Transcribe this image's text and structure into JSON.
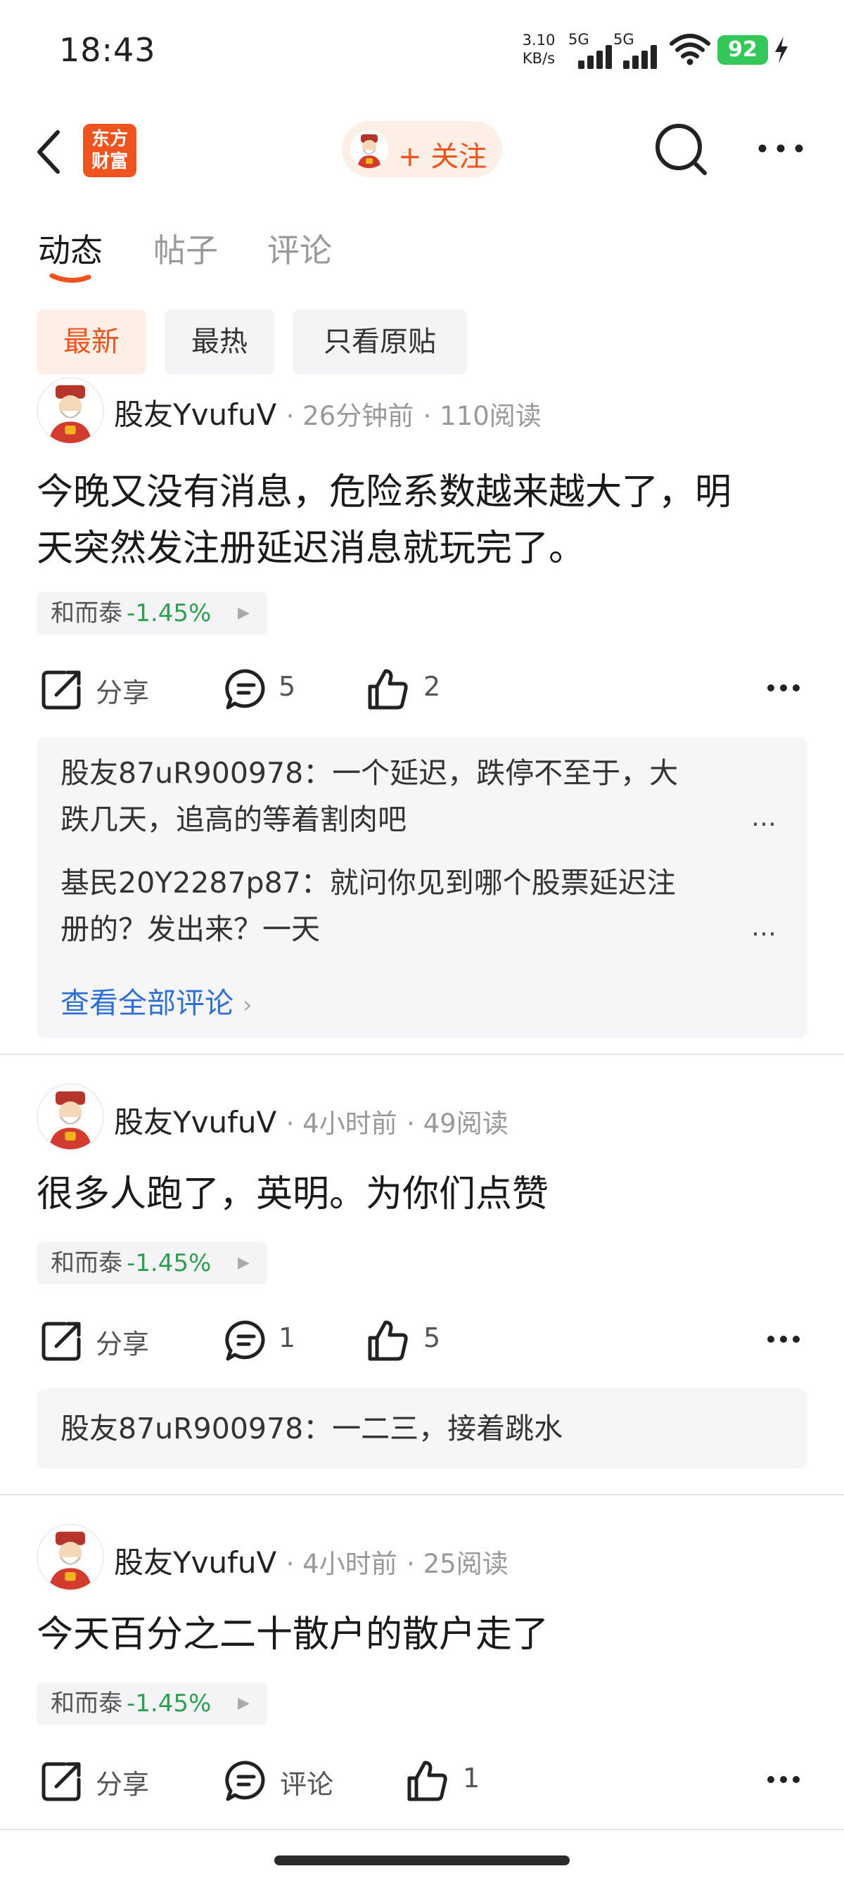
{
  "status_bar": {
    "time": "18:43",
    "net_speed_value": "3.10",
    "net_speed_unit": "KB/s",
    "sim1_label": "5G",
    "sim2_label": "5G",
    "battery": "92",
    "icons": [
      "signal-icon",
      "wifi-icon",
      "battery-icon",
      "charging-icon"
    ]
  },
  "nav": {
    "logo_line1": "东方",
    "logo_line2": "财富",
    "follow_label": "+ 关注",
    "icons": [
      "back-icon",
      "search-icon",
      "more-icon"
    ]
  },
  "tabs": [
    {
      "label": "动态",
      "active": true
    },
    {
      "label": "帖子",
      "active": false
    },
    {
      "label": "评论",
      "active": false
    }
  ],
  "filters": [
    {
      "label": "最新",
      "active": true
    },
    {
      "label": "最热",
      "active": false
    },
    {
      "label": "只看原贴",
      "active": false
    }
  ],
  "posts": [
    {
      "user": "股友YvufuV",
      "time": "26分钟前",
      "reads": "110阅读",
      "body_line1": "今晚又没有消息，危险系数越来越大了，明",
      "body_line2": "天突然发注册延迟消息就玩完了。",
      "stock_name": "和而泰",
      "stock_change": "-1.45%",
      "share_label": "分享",
      "comment_count": "5",
      "like_count": "2",
      "comments": [
        {
          "line1": "股友87uR900978：一个延迟，跌停不至于，大",
          "line2": "跌几天，追高的等着割肉吧"
        },
        {
          "line1": "基民20Y2287p87：就问你见到哪个股票延迟注",
          "line2": "册的？发出来？一天"
        }
      ],
      "view_all": "查看全部评论"
    },
    {
      "user": "股友YvufuV",
      "time": "4小时前",
      "reads": "49阅读",
      "body_line1": "很多人跑了，英明。为你们点赞",
      "stock_name": "和而泰",
      "stock_change": "-1.45%",
      "share_label": "分享",
      "comment_count": "1",
      "like_count": "5",
      "comments": [
        {
          "line1": "股友87uR900978：一二三，接着跳水"
        }
      ]
    },
    {
      "user": "股友YvufuV",
      "time": "4小时前",
      "reads": "25阅读",
      "body_line1": "今天百分之二十散户的散户走了",
      "stock_name": "和而泰",
      "stock_change": "-1.45%",
      "share_label": "分享",
      "comment_label": "评论",
      "like_count": "1"
    }
  ],
  "colors": {
    "accent": "#f0541e",
    "accent_bg": "#fdeee6",
    "down_green": "#2e9f4e",
    "link_blue": "#2d6fd2"
  }
}
